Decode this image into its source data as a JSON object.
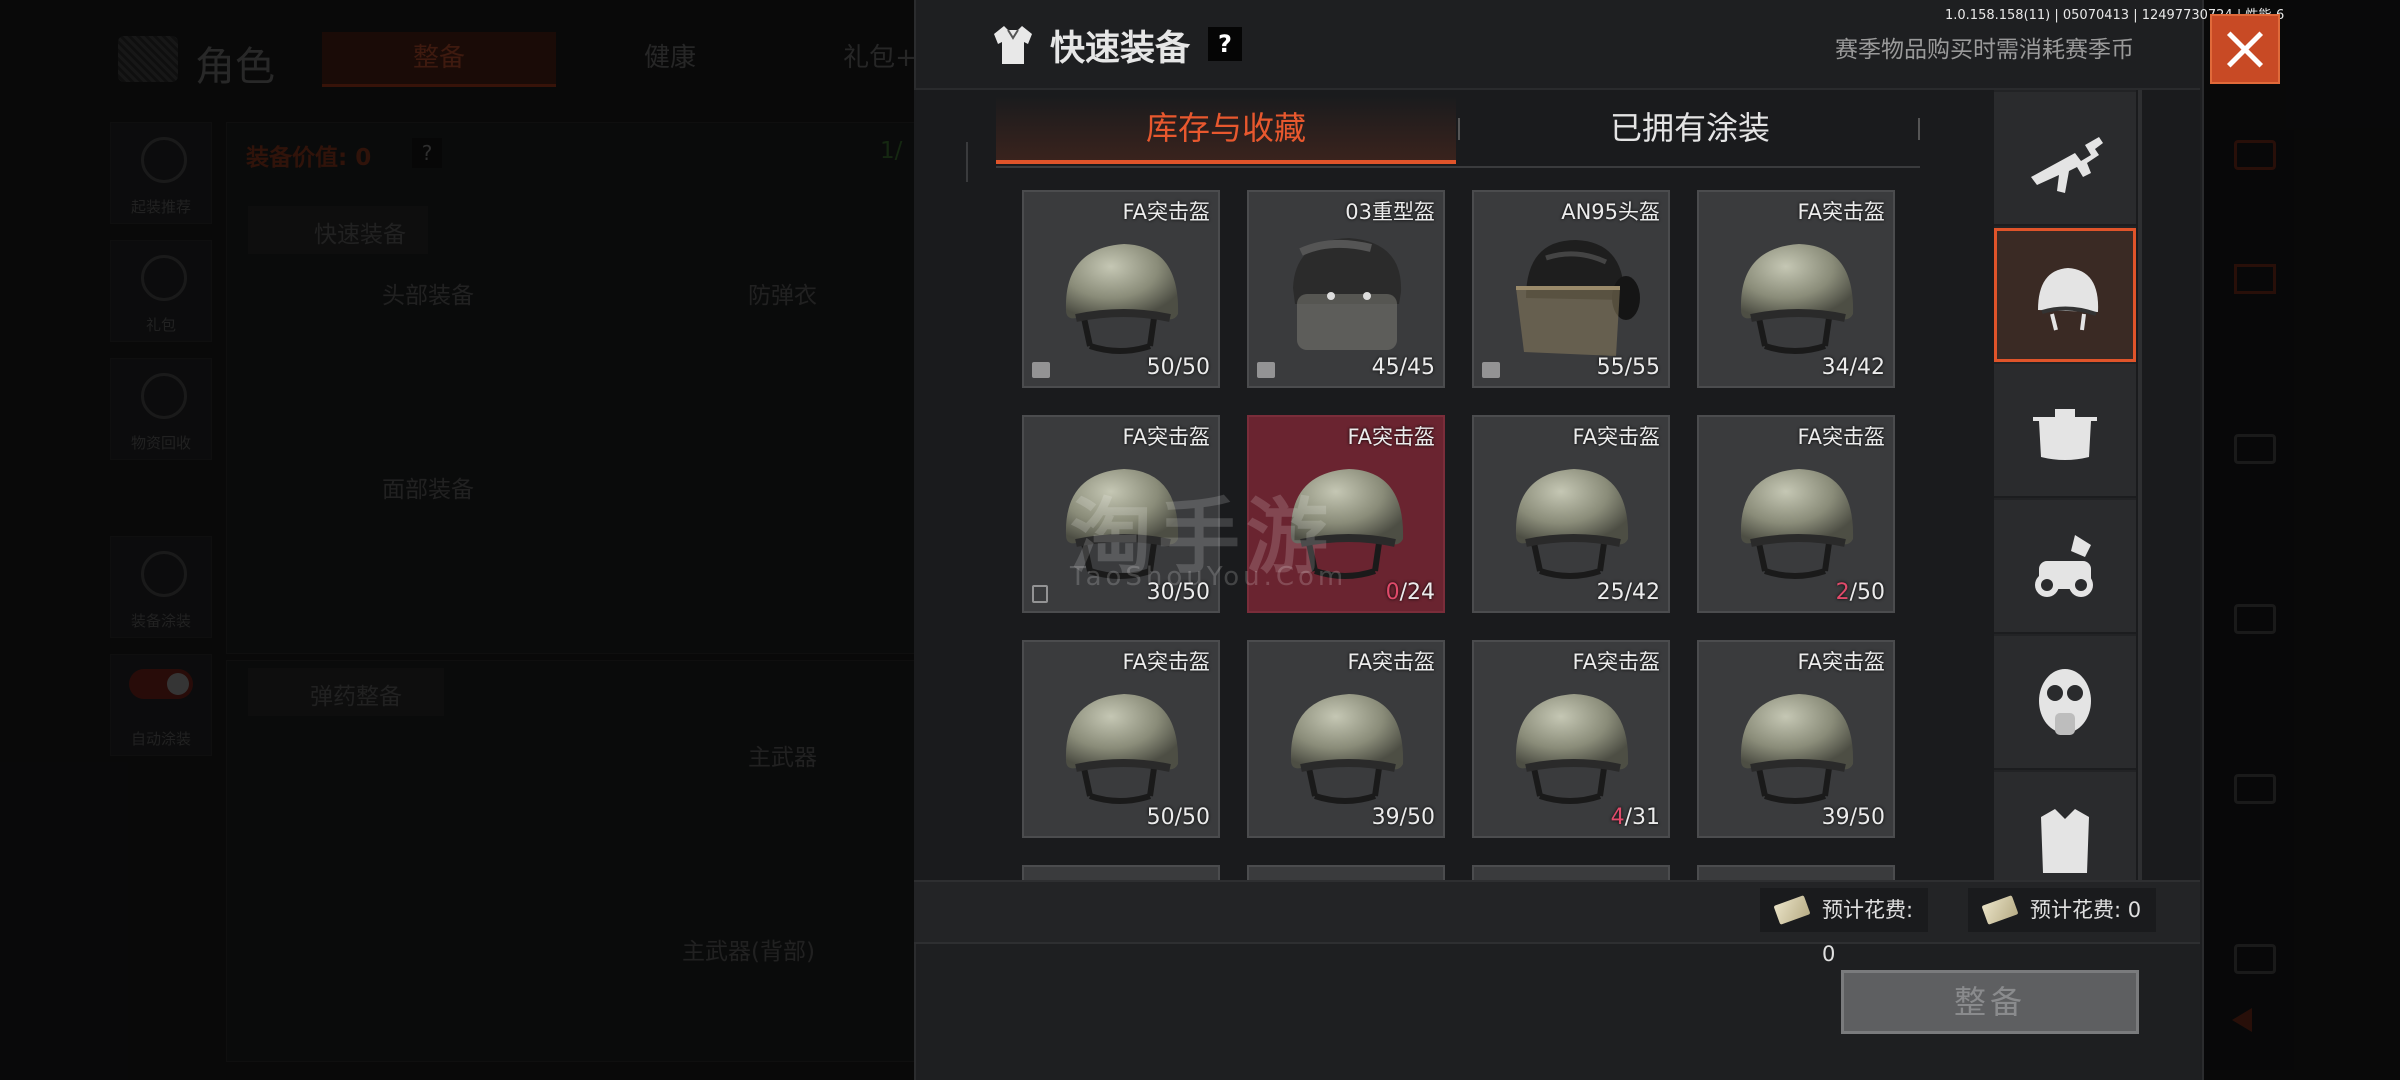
{
  "version_info": "1.0.158.158(11) | 05070413 | 12497730724 | 性能-6",
  "background": {
    "title": "角色",
    "tabs": [
      "整备",
      "健康",
      "礼包+"
    ],
    "equip_value_label": "装备价值: 0",
    "help": "?",
    "count_text": "1/",
    "quick_equip": "快速装备",
    "head_gear": "头部装备",
    "body_armor": "防弹衣",
    "face_gear": "面部装备",
    "ammo_section": "弹药整备",
    "primary_weapon": "主武器",
    "primary_weapon_back": "主武器(背部)",
    "side_buttons": [
      "起装推荐",
      "礼包",
      "物资回收",
      "装备涂装",
      "自动涂装"
    ]
  },
  "modal": {
    "title": "快速装备",
    "help": "?",
    "notice": "赛季物品购买时需消耗赛季币",
    "tabs": [
      {
        "label": "库存与收藏",
        "active": true
      },
      {
        "label": "已拥有涂装",
        "active": false
      }
    ],
    "items": [
      {
        "name": "FA突击盔",
        "count_hi": "",
        "count_rest": "50/50",
        "style": "fa",
        "badge": "box"
      },
      {
        "name": "03重型盔",
        "count_hi": "",
        "count_rest": "45/45",
        "style": "heavy",
        "badge": "box"
      },
      {
        "name": "AN95头盔",
        "count_hi": "",
        "count_rest": "55/55",
        "style": "an95",
        "badge": "box"
      },
      {
        "name": "FA突击盔",
        "count_hi": "",
        "count_rest": "34/42",
        "style": "fa",
        "badge": ""
      },
      {
        "name": "FA突击盔",
        "count_hi": "",
        "count_rest": "30/50",
        "style": "fa",
        "badge": "exit"
      },
      {
        "name": "FA突击盔",
        "count_hi": "0",
        "count_rest": "/24",
        "style": "fa",
        "badge": "",
        "selected": true
      },
      {
        "name": "FA突击盔",
        "count_hi": "",
        "count_rest": "25/42",
        "style": "fa",
        "badge": ""
      },
      {
        "name": "FA突击盔",
        "count_hi": "2",
        "count_rest": "/50",
        "style": "fa",
        "badge": ""
      },
      {
        "name": "FA突击盔",
        "count_hi": "",
        "count_rest": "50/50",
        "style": "fa",
        "badge": ""
      },
      {
        "name": "FA突击盔",
        "count_hi": "",
        "count_rest": "39/50",
        "style": "fa",
        "badge": ""
      },
      {
        "name": "FA突击盔",
        "count_hi": "4",
        "count_rest": "/31",
        "style": "fa",
        "badge": ""
      },
      {
        "name": "FA突击盔",
        "count_hi": "",
        "count_rest": "39/50",
        "style": "fa",
        "badge": ""
      }
    ],
    "categories": [
      {
        "icon": "rifle-icon",
        "active": false
      },
      {
        "icon": "helmet-icon",
        "active": true
      },
      {
        "icon": "pot-icon",
        "active": false
      },
      {
        "icon": "night-vision-icon",
        "active": false
      },
      {
        "icon": "gas-mask-icon",
        "active": false
      },
      {
        "icon": "vest-icon",
        "active": false
      }
    ],
    "cost_a": "预计花费: 0",
    "cost_b": "预计花费: 0",
    "equip_button": "整备"
  },
  "watermark": {
    "main": "淘手游",
    "sub": "TaoShouYou.Com"
  },
  "colors": {
    "accent": "#e0542a",
    "highlight_count": "#e04a6a",
    "close": "#c84a25"
  }
}
